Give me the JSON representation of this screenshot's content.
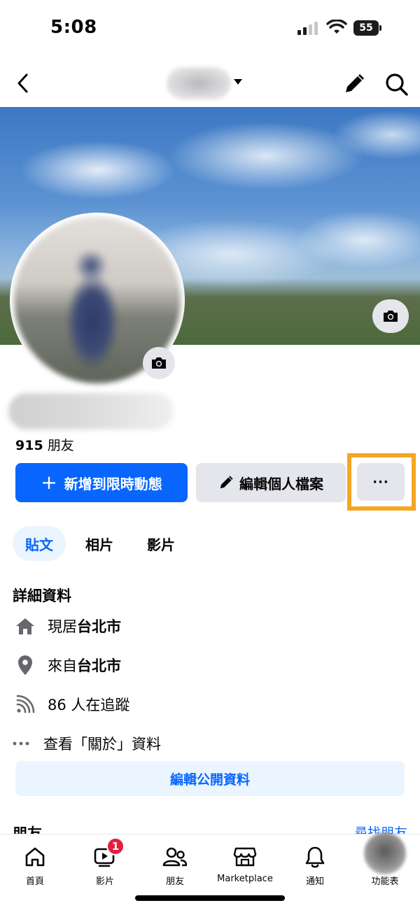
{
  "status_bar": {
    "time": "5:08",
    "battery": "55"
  },
  "profile": {
    "friends_count": "915",
    "friends_label": "朋友"
  },
  "actions": {
    "add_story": "新增到限時動態",
    "add_story_plus": "+",
    "edit_profile": "編輯個人檔案",
    "more": "···"
  },
  "tabs": [
    {
      "label": "貼文",
      "selected": true
    },
    {
      "label": "相片",
      "selected": false
    },
    {
      "label": "影片",
      "selected": false
    }
  ],
  "details": {
    "title": "詳細資料",
    "residence_prefix": "現居",
    "residence_city": "台北市",
    "from_prefix": "來自",
    "from_city": "台北市",
    "followers": "86 人在追蹤",
    "about": "查看「關於」資料",
    "edit_public": "編輯公開資料"
  },
  "friends_section": {
    "title": "朋友",
    "find_friends": "尋找朋友"
  },
  "tabbar": {
    "home": "首頁",
    "video": "影片",
    "video_badge": "1",
    "friends": "朋友",
    "marketplace": "Marketplace",
    "notifications": "通知",
    "menu": "功能表"
  },
  "colors": {
    "accent": "#0866ff",
    "highlight": "#f5a623",
    "badge": "#e41e3f",
    "button_gray": "#e4e6eb"
  }
}
